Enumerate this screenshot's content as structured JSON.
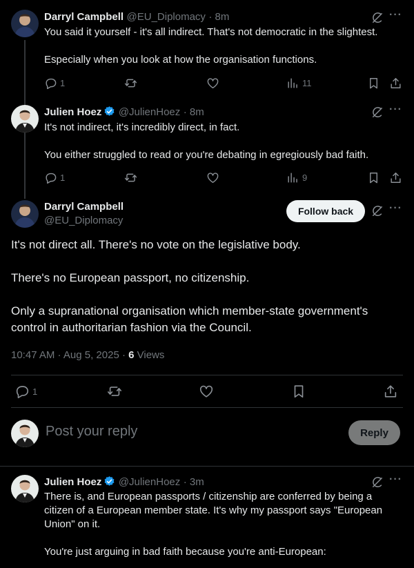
{
  "replies": [
    {
      "name": "Darryl Campbell",
      "handle": "@EU_Diplomacy",
      "time": "· 8m",
      "text": "You said it yourself - it's all indirect. That's not democratic in the slightest.\n\nEspecially when you look at how the organisation functions.",
      "replies_count": "1",
      "views": "11"
    },
    {
      "name": "Julien Hoez",
      "handle": "@JulienHoez",
      "time": "· 8m",
      "verified": true,
      "text": "It's not indirect, it's incredibly direct, in fact.\n\nYou either struggled to read or you're debating in egregiously bad faith.",
      "replies_count": "1",
      "views": "9"
    }
  ],
  "main_post": {
    "name": "Darryl Campbell",
    "handle": "@EU_Diplomacy",
    "follow_label": "Follow back",
    "text": "It's not direct all. There's no vote on the legislative body.\n\nThere's no European passport, no citizenship.\n\nOnly a supranational organisation which member-state government's control in authoritarian fashion via the Council.",
    "timestamp": "10:47 AM · Aug 5, 2025 · ",
    "views_count": "6",
    "views_label": " Views",
    "replies_count": "1"
  },
  "compose": {
    "placeholder": "Post your reply",
    "reply_label": "Reply"
  },
  "bottom_reply": {
    "name": "Julien Hoez",
    "handle": "@JulienHoez",
    "time": "· 3m",
    "verified": true,
    "text": "There is, and European passports / citizenship are conferred by being a citizen of a European member state. It's why my passport says \"European Union\" on it.\n\nYou're just arguing in bad faith because you're anti-European:"
  },
  "colors": {
    "background": "#000000",
    "text": "#e7e9ea",
    "muted": "#71767b",
    "divider": "#2f3336",
    "verified": "#1d9bf0"
  }
}
